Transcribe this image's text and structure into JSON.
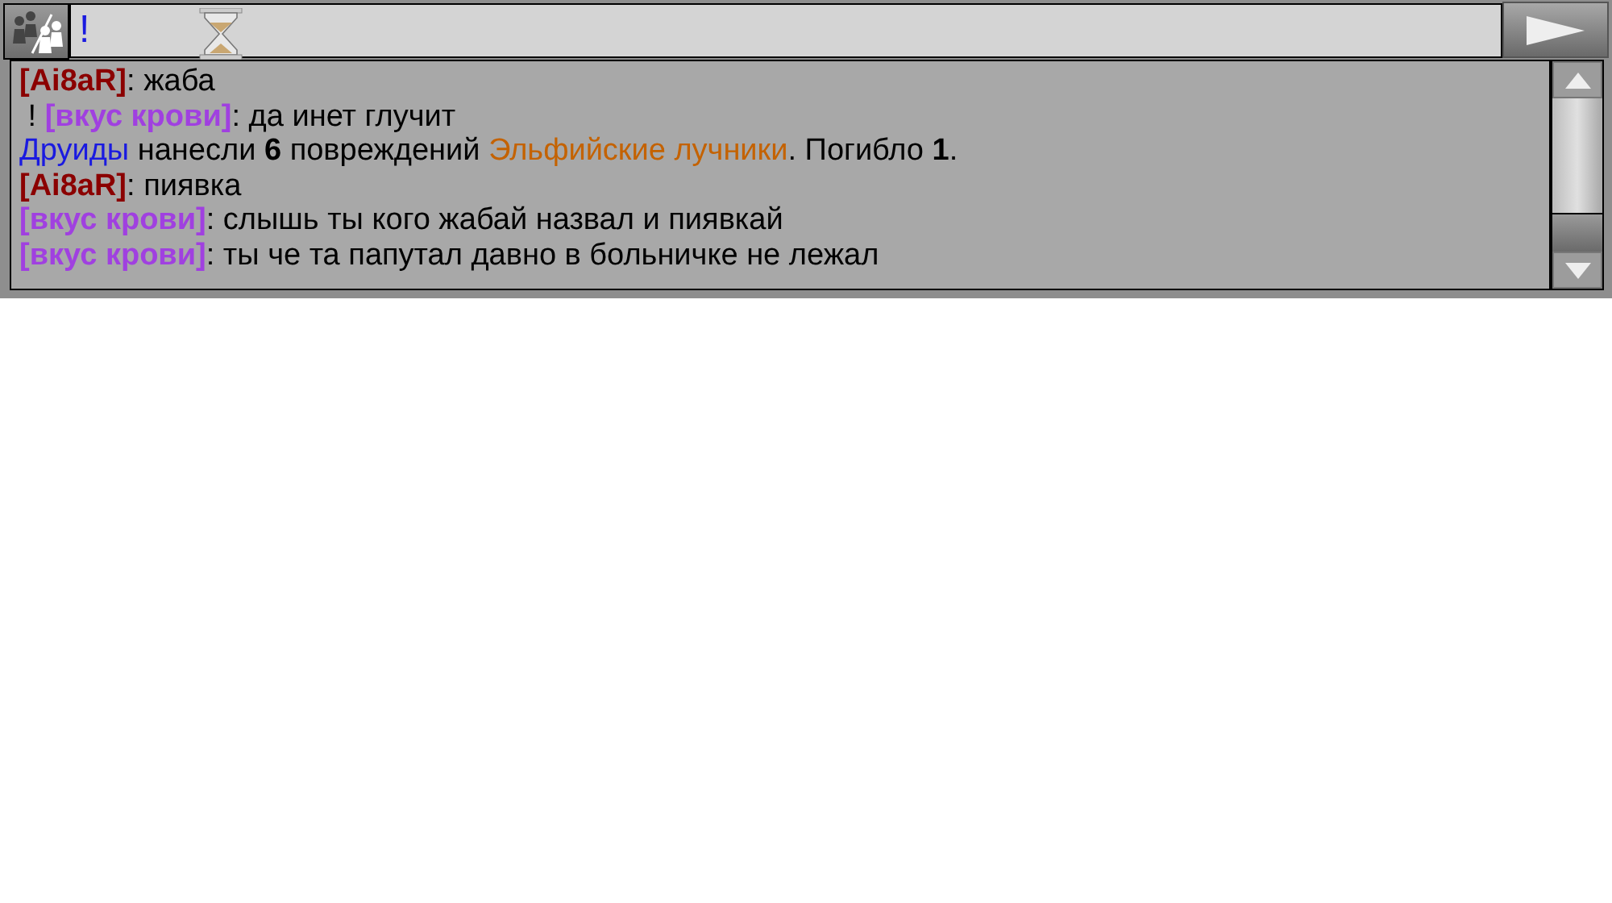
{
  "input": {
    "value": "!"
  },
  "messages": [
    {
      "segments": [
        {
          "text": "[Ai8aR]",
          "color": "#8b0000",
          "bold": true
        },
        {
          "text": ": жаба",
          "color": "#000000",
          "bold": false
        }
      ]
    },
    {
      "segments": [
        {
          "text": " ! ",
          "color": "#000000",
          "bold": false
        },
        {
          "text": "[вкус крови]",
          "color": "#a040e0",
          "bold": true
        },
        {
          "text": ": да инет глучит",
          "color": "#000000",
          "bold": false
        }
      ]
    },
    {
      "segments": [
        {
          "text": "Друиды",
          "color": "#1a1ae0",
          "bold": false
        },
        {
          "text": " нанесли ",
          "color": "#000000",
          "bold": false
        },
        {
          "text": "6",
          "color": "#000000",
          "bold": true
        },
        {
          "text": " повреждений ",
          "color": "#000000",
          "bold": false
        },
        {
          "text": "Эльфийские лучники",
          "color": "#c46200",
          "bold": false
        },
        {
          "text": ". Погибло ",
          "color": "#000000",
          "bold": false
        },
        {
          "text": "1",
          "color": "#000000",
          "bold": true
        },
        {
          "text": ".",
          "color": "#000000",
          "bold": false
        }
      ]
    },
    {
      "segments": [
        {
          "text": "[Ai8aR]",
          "color": "#8b0000",
          "bold": true
        },
        {
          "text": ": пиявка",
          "color": "#000000",
          "bold": false
        }
      ]
    },
    {
      "segments": [
        {
          "text": "[вкус крови]",
          "color": "#a040e0",
          "bold": true
        },
        {
          "text": ": слышь ты кого жабай назвал и пиявкай",
          "color": "#000000",
          "bold": false
        }
      ]
    },
    {
      "segments": [
        {
          "text": "[вкус крови]",
          "color": "#a040e0",
          "bold": true
        },
        {
          "text": ": ты че та папутал давно в больничке не лежал",
          "color": "#000000",
          "bold": false
        }
      ]
    }
  ]
}
